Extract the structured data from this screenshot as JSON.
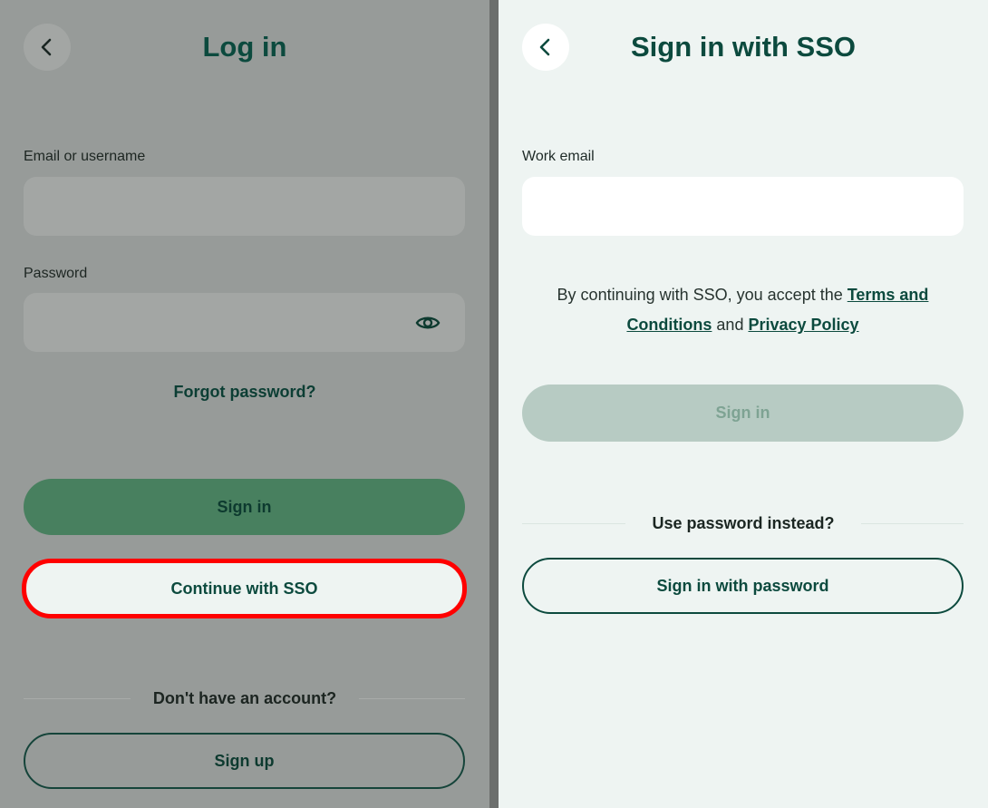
{
  "login": {
    "title": "Log in",
    "email_label": "Email or username",
    "email_value": "",
    "password_label": "Password",
    "password_value": "",
    "forgot_password": "Forgot password?",
    "sign_in_label": "Sign in",
    "sso_label": "Continue with SSO",
    "no_account_text": "Don't have an account?",
    "sign_up_label": "Sign up"
  },
  "sso": {
    "title": "Sign in with SSO",
    "work_email_label": "Work email",
    "work_email_value": "",
    "terms_prefix": "By continuing with SSO, you accept the ",
    "terms_link": "Terms and Conditions",
    "terms_middle": " and ",
    "privacy_link": "Privacy Policy",
    "sign_in_label": "Sign in",
    "use_password_text": "Use password instead?",
    "sign_in_password_label": "Sign in with password"
  },
  "icons": {
    "back": "chevron-left-icon",
    "eye": "eye-icon"
  },
  "colors": {
    "brand_dark": "#0c4a3e",
    "primary_green": "#48805f",
    "highlight_red": "#ff0000",
    "panel_light": "#eef4f2",
    "disabled_button": "#b7cbc3"
  }
}
